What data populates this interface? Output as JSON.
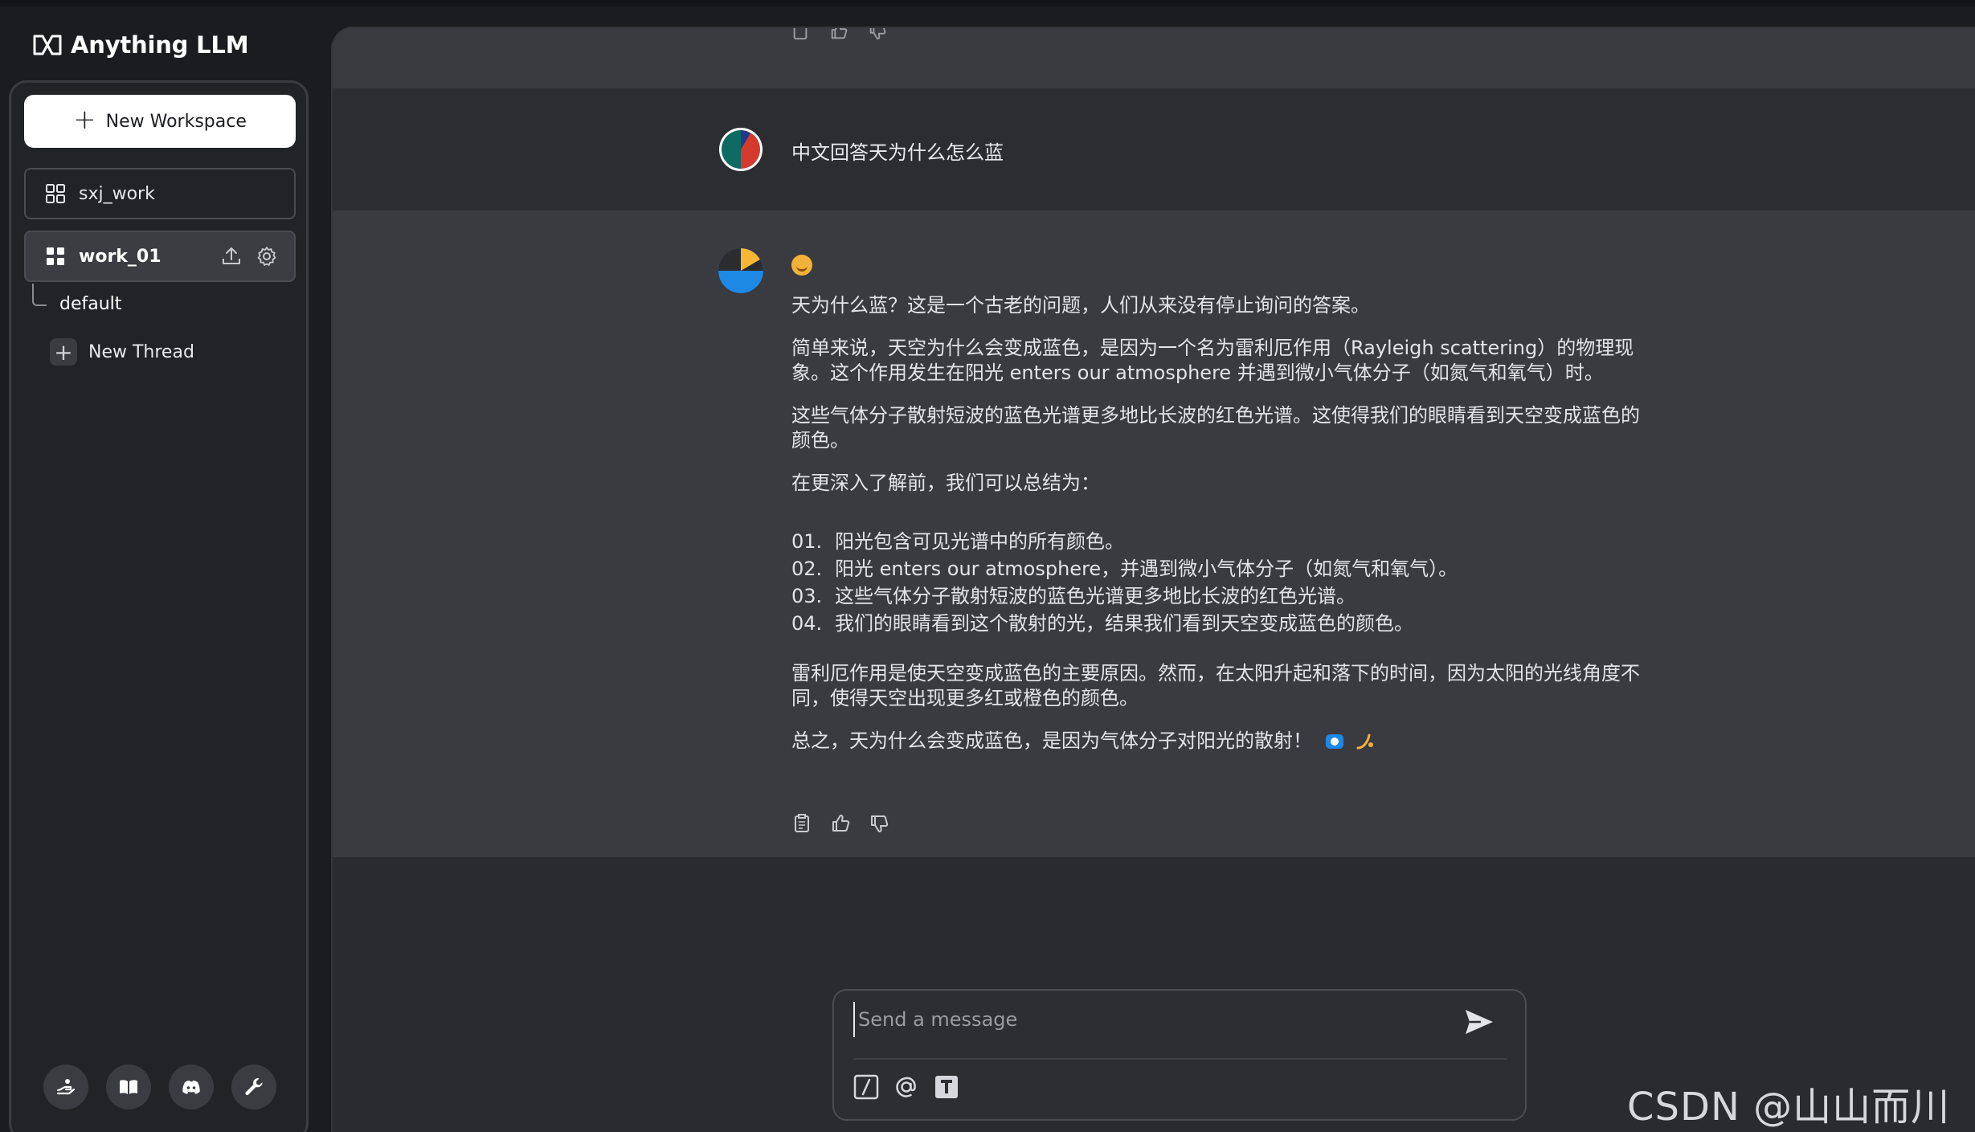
{
  "brand": {
    "name": "Anything LLM"
  },
  "sidebar": {
    "new_workspace_label": "New Workspace",
    "workspaces": [
      {
        "name": "sxj_work",
        "active": false
      },
      {
        "name": "work_01",
        "active": true
      }
    ],
    "threads": [
      {
        "name": "default"
      }
    ],
    "new_thread_label": "New Thread",
    "footer_icons": [
      "community-hub-icon",
      "docs-book-icon",
      "discord-icon",
      "settings-wrench-icon"
    ]
  },
  "chat": {
    "user_message": "中文回答天为什么怎么蓝",
    "assistant": {
      "paragraphs": [
        "天为什么蓝？这是一个古老的问题，人们从来没有停止询问的答案。",
        "简单来说，天空为什么会变成蓝色，是因为一个名为雷利厄作用（Rayleigh scattering）的物理现象。这个作用发生在阳光 enters our atmosphere 并遇到微小气体分子（如氮气和氧气）时。",
        "这些气体分子散射短波的蓝色光谱更多地比长波的红色光谱。这使得我们的眼睛看到天空变成蓝色的颜色。",
        "在更深入了解前，我们可以总结为："
      ],
      "list": [
        {
          "num": "01.",
          "text": "阳光包含可见光谱中的所有颜色。"
        },
        {
          "num": "02.",
          "text": "阳光 enters our atmosphere，并遇到微小气体分子（如氮气和氧气）。"
        },
        {
          "num": "03.",
          "text": "这些气体分子散射短波的蓝色光谱更多地比长波的红色光谱。"
        },
        {
          "num": "04.",
          "text": "我们的眼睛看到这个散射的光，结果我们看到天空变成蓝色的颜色。"
        }
      ],
      "after_list": [
        "雷利厄作用是使天空变成蓝色的主要原因。然而，在太阳升起和落下的时间，因为太阳的光线角度不同，使得天空出现更多红或橙色的颜色。",
        "总之，天为什么会变成蓝色，是因为气体分子对阳光的散射！"
      ]
    }
  },
  "composer": {
    "placeholder": "Send a message"
  },
  "watermark": "CSDN @山山而川_R"
}
